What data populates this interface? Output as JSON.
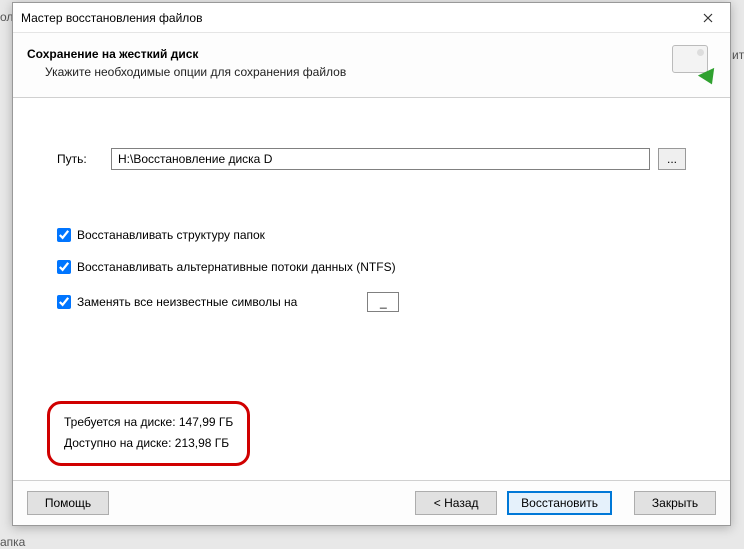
{
  "titlebar": {
    "title": "Мастер восстановления файлов"
  },
  "header": {
    "title": "Сохранение на жесткий диск",
    "subtitle": "Укажите необходимые опции для сохранения файлов"
  },
  "path": {
    "label": "Путь:",
    "value": "H:\\Восстановление диска D",
    "browse": "..."
  },
  "checks": {
    "restore_structure": "Восстанавливать структуру папок",
    "restore_ads": "Восстанавливать альтернативные потоки данных (NTFS)",
    "replace_unknown": "Заменять все неизвестные символы на",
    "replace_value": "_"
  },
  "disk": {
    "required": "Требуется на диске: 147,99 ГБ",
    "available": "Доступно на диске: 213,98 ГБ"
  },
  "buttons": {
    "help": "Помощь",
    "back": "< Назад",
    "recover": "Восстановить",
    "close": "Закрыть"
  },
  "bg": {
    "f1": "ол",
    "f2": "итель",
    "f3": "апка"
  }
}
